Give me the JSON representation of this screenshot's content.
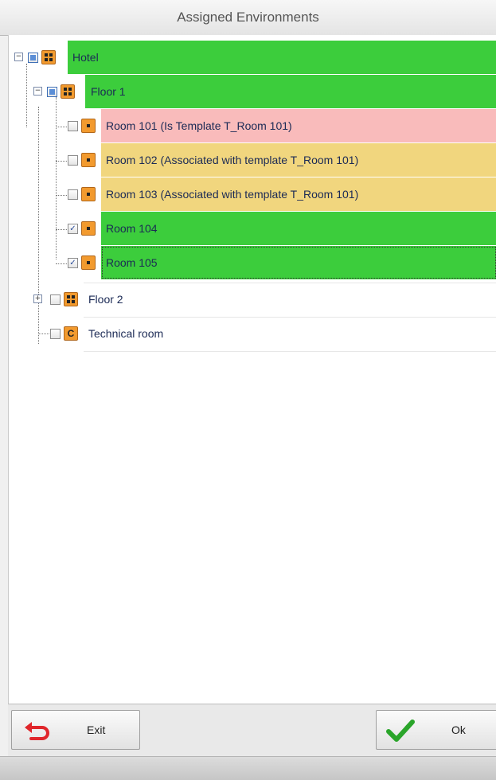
{
  "window": {
    "title": "Assigned Environments"
  },
  "tree": {
    "hotel": {
      "label": "Hotel",
      "icon": "grid-icon",
      "state": "partial",
      "color": "#3ccd3c"
    },
    "floor1": {
      "label": "Floor 1",
      "icon": "grid-icon",
      "state": "partial",
      "color": "#3ccd3c"
    },
    "rooms": [
      {
        "label": "Room 101 (Is Template T_Room 101)",
        "checked": false,
        "color": "#f9bbbb"
      },
      {
        "label": "Room 102 (Associated with template T_Room 101)",
        "checked": false,
        "color": "#f1d67e"
      },
      {
        "label": "Room 103 (Associated with template T_Room 101)",
        "checked": false,
        "color": "#f1d67e"
      },
      {
        "label": "Room 104",
        "checked": true,
        "color": "#3ccd3c"
      },
      {
        "label": "Room 105",
        "checked": true,
        "color": "#3ccd3c"
      }
    ],
    "floor2": {
      "label": "Floor 2",
      "checked": false
    },
    "technical": {
      "label": "Technical room",
      "icon_letter": "C",
      "checked": false
    }
  },
  "buttons": {
    "exit_label": "Exit",
    "ok_label": "Ok"
  },
  "colors": {
    "exit_icon": "#e0262b",
    "ok_icon": "#2aa52a"
  }
}
